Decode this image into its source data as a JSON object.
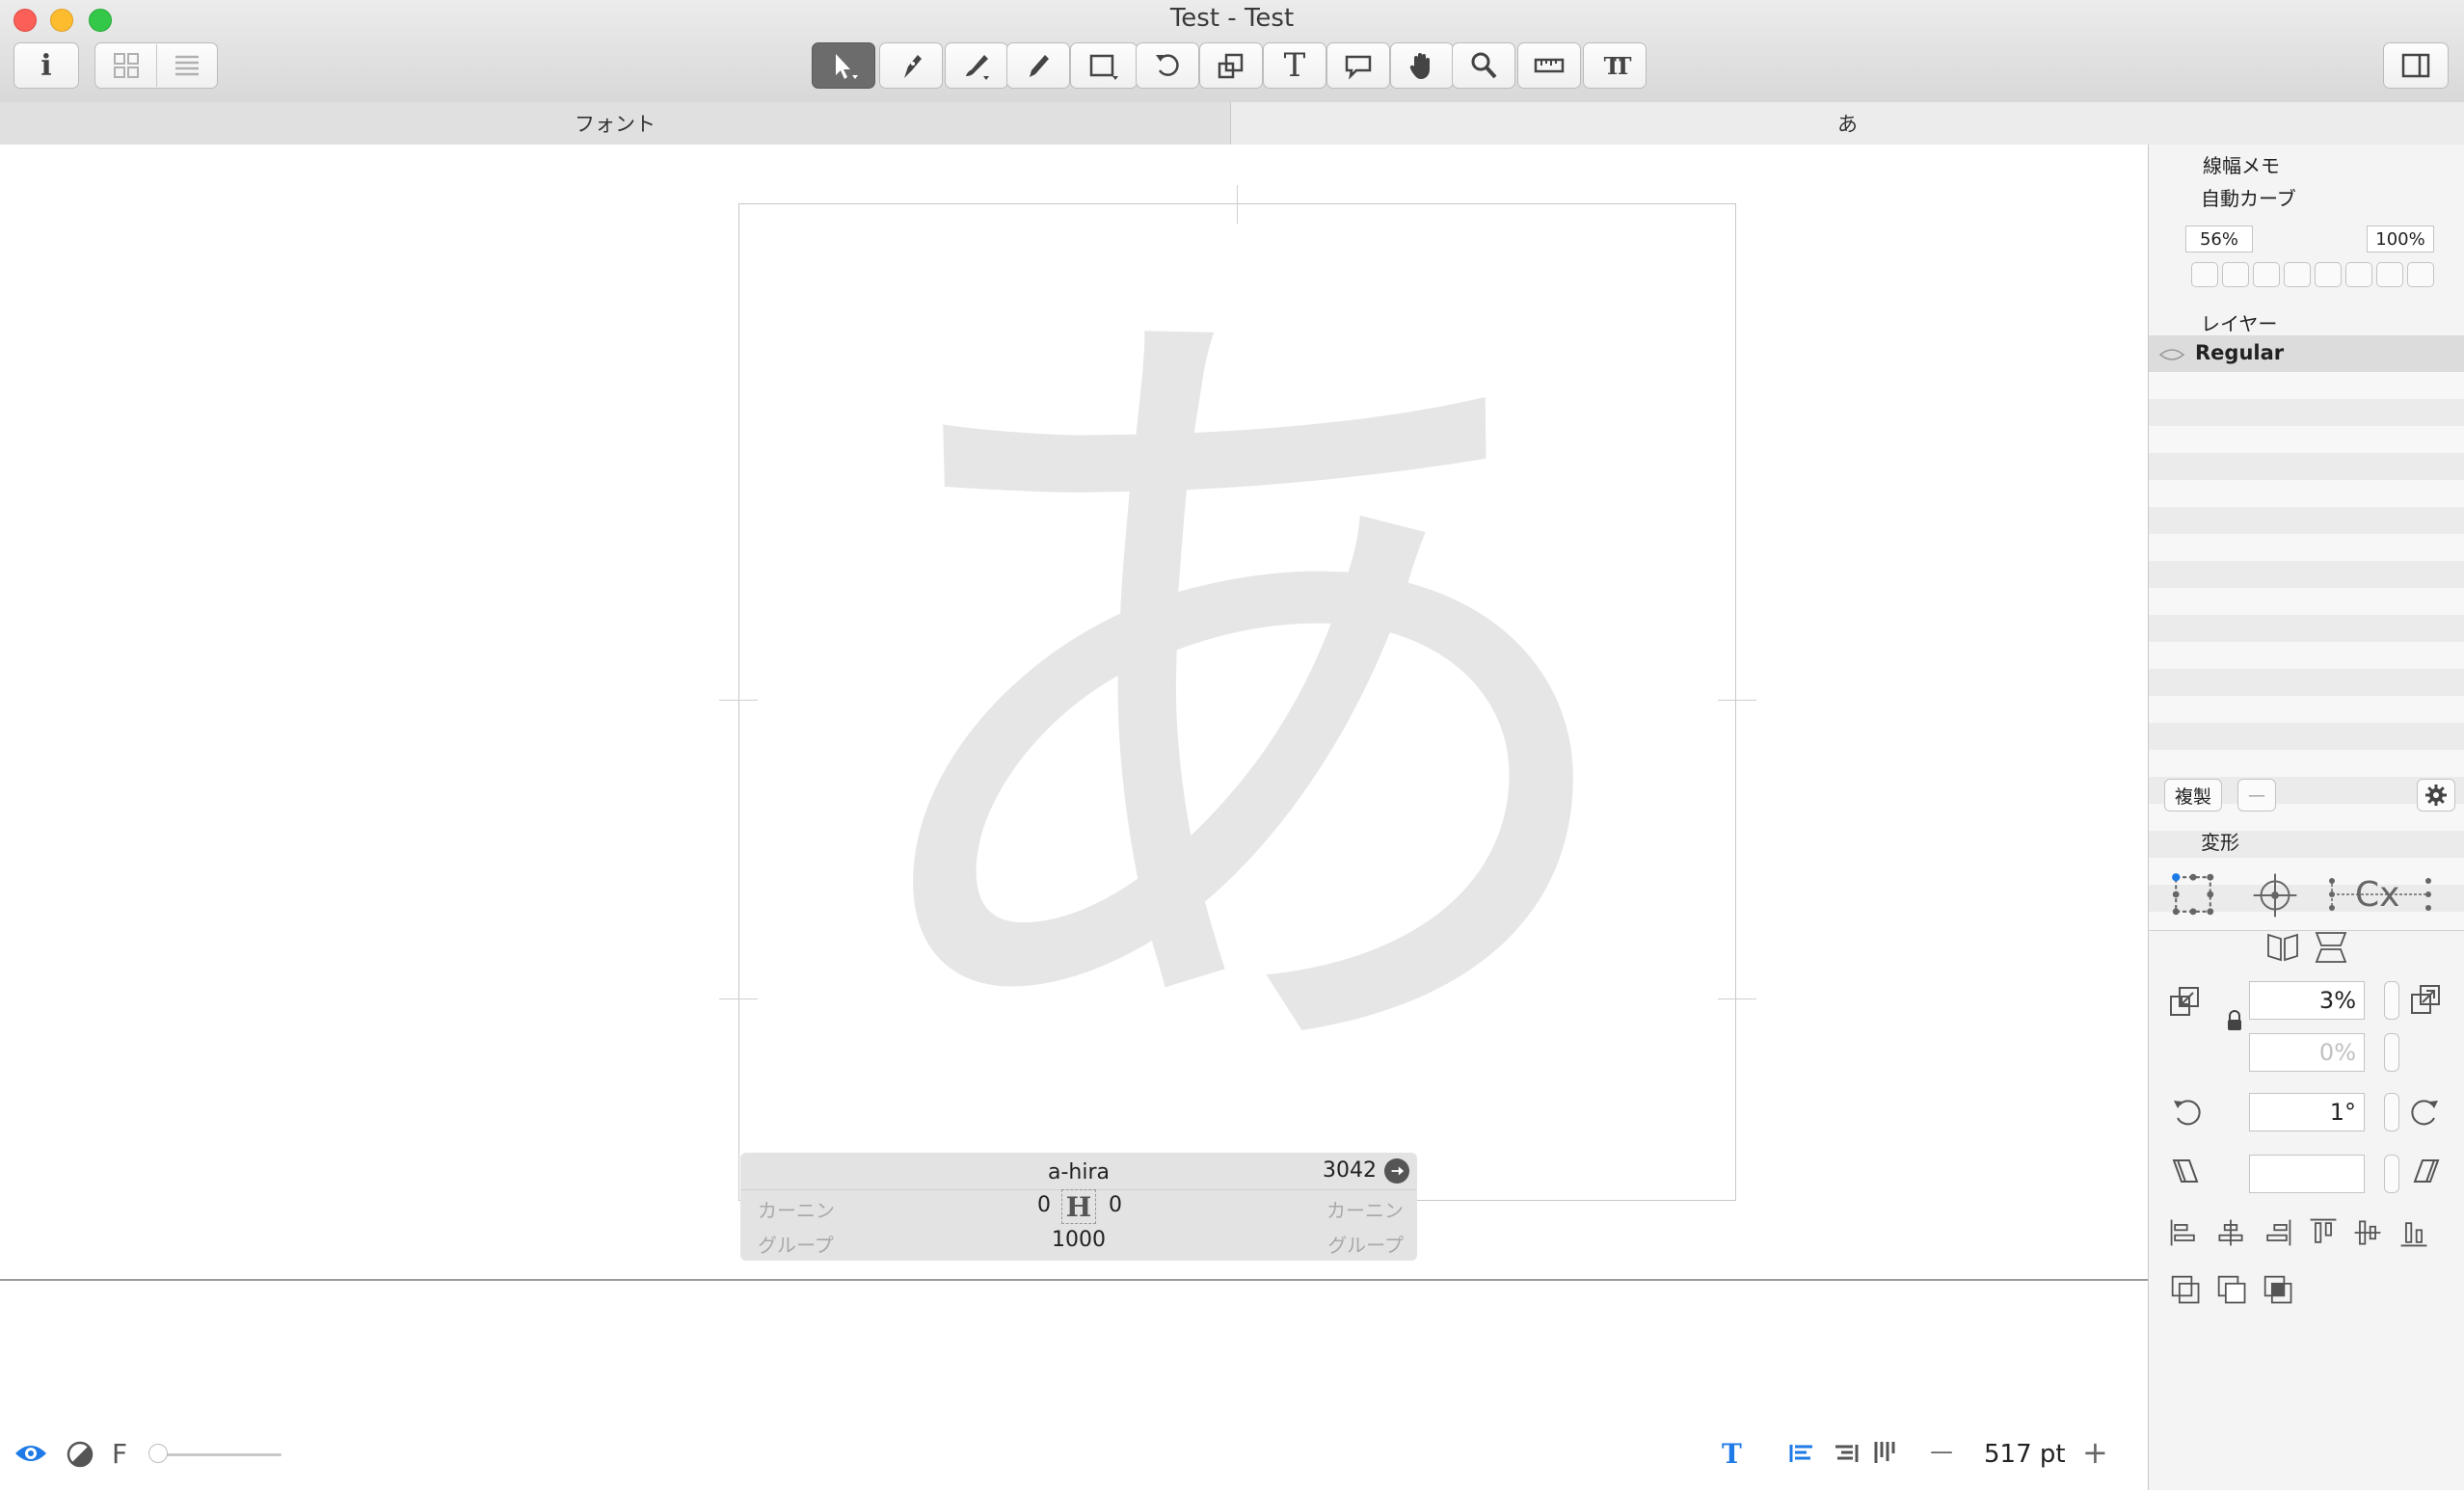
{
  "window": {
    "title": "Test - Test"
  },
  "toolbar": {
    "left_buttons": [
      {
        "icon": "info-icon",
        "label": "i"
      },
      {
        "icon": "grid-view-icon"
      },
      {
        "icon": "list-view-icon"
      }
    ],
    "tools": [
      {
        "icon": "select-arrow-icon",
        "active": true
      },
      {
        "icon": "pen-icon"
      },
      {
        "icon": "brush-icon"
      },
      {
        "icon": "pencil-icon"
      },
      {
        "icon": "rectangle-icon"
      },
      {
        "icon": "rotate-icon"
      },
      {
        "icon": "scale-icon"
      },
      {
        "icon": "text-icon",
        "label": "T"
      },
      {
        "icon": "annotation-icon"
      },
      {
        "icon": "hand-icon"
      },
      {
        "icon": "zoom-icon"
      },
      {
        "icon": "ruler-icon"
      },
      {
        "icon": "type-tool-icon",
        "label": "TT"
      }
    ],
    "right_button": {
      "icon": "sidebar-toggle-icon"
    }
  },
  "tabs": [
    {
      "label": "フォント",
      "active": false
    },
    {
      "label": "あ",
      "active": true
    }
  ],
  "canvas": {
    "glyph_char": "あ",
    "info_panel": {
      "glyph_name": "a-hira",
      "unicode_value": "3042",
      "left_kerning_label": "カーニン",
      "right_kerning_label": "カーニン",
      "left_sidebearing": "0",
      "right_sidebearing": "0",
      "left_group_label": "グループ",
      "right_group_label": "グループ",
      "width": "1000"
    }
  },
  "sidebar": {
    "sections": {
      "stroke_memo": "線幅メモ",
      "auto_curve": "自動カーブ",
      "auto_curve_min": "56%",
      "auto_curve_max": "100%",
      "layers": "レイヤー",
      "layer_active": "Regular"
    },
    "layer_buttons": {
      "duplicate": "複製",
      "remove": "—"
    },
    "transform": {
      "title": "変形",
      "scale_value": "3%",
      "scale_value_2": "0%",
      "rotate_value": "1°",
      "skew_value": ""
    }
  },
  "bottom_bar": {
    "font_label": "F",
    "font_size": "517 pt",
    "minus": "—",
    "plus": "+"
  },
  "colors": {
    "accent": "#1e7ae6",
    "close": "#fc5f57",
    "minimize": "#fdbc2e",
    "zoom": "#34c84a",
    "glyph_fill": "#e6e6e6"
  }
}
